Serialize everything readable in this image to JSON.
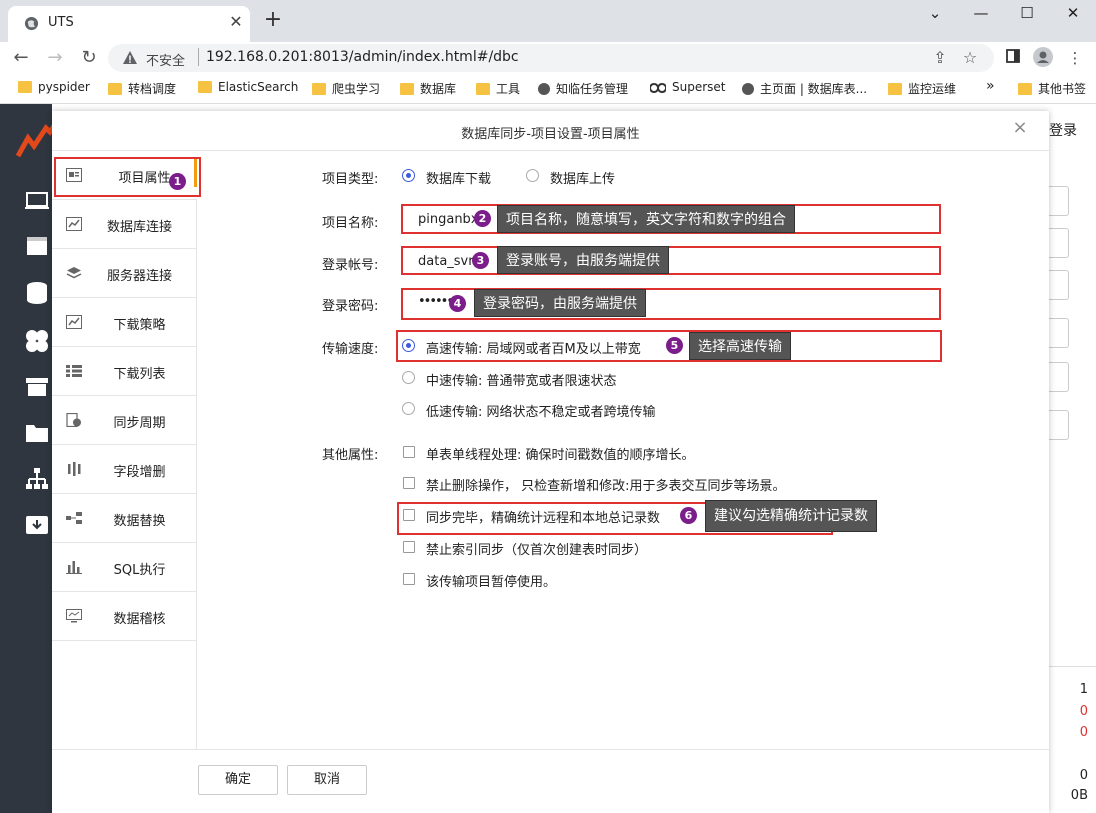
{
  "browser": {
    "tab_title": "UTS",
    "insecure_label": "不安全",
    "url": "192.168.0.201:8013/admin/index.html#/dbc",
    "bookmarks": [
      {
        "label": "pyspider",
        "icon": "folder"
      },
      {
        "label": "转档调度",
        "icon": "folder"
      },
      {
        "label": "ElasticSearch",
        "icon": "folder"
      },
      {
        "label": "爬虫学习",
        "icon": "folder"
      },
      {
        "label": "数据库",
        "icon": "folder"
      },
      {
        "label": "工具",
        "icon": "folder"
      },
      {
        "label": "知临任务管理",
        "icon": "globe"
      },
      {
        "label": "Superset",
        "icon": "superset"
      },
      {
        "label": "主页面 | 数据库表...",
        "icon": "globe"
      },
      {
        "label": "监控运维",
        "icon": "folder"
      }
    ],
    "more_label": "»",
    "other_bookmarks": "其他书签"
  },
  "app": {
    "login_label": "登录",
    "right_numbers": [
      "1",
      "0",
      "0",
      "0",
      "0B"
    ]
  },
  "modal": {
    "title": "数据库同步-项目设置-项目属性",
    "close_glyph": "×",
    "menu": [
      {
        "label": "项目属性",
        "icon": "card-icon"
      },
      {
        "label": "数据库连接",
        "icon": "chart-icon"
      },
      {
        "label": "服务器连接",
        "icon": "layers-icon"
      },
      {
        "label": "下载策略",
        "icon": "chart-icon"
      },
      {
        "label": "下载列表",
        "icon": "list-icon"
      },
      {
        "label": "同步周期",
        "icon": "clock-doc-icon"
      },
      {
        "label": "字段增删",
        "icon": "columns-icon"
      },
      {
        "label": "数据替换",
        "icon": "swap-icon"
      },
      {
        "label": "SQL执行",
        "icon": "bar-icon"
      },
      {
        "label": "数据稽核",
        "icon": "monitor-icon"
      }
    ],
    "form": {
      "type_label": "项目类型:",
      "type_options": [
        "数据库下载",
        "数据库上传"
      ],
      "name_label": "项目名称:",
      "name_value": "pinganbx",
      "account_label": "登录帐号:",
      "account_value": "data_svr",
      "password_label": "登录密码:",
      "password_value": "••••••",
      "speed_label": "传输速度:",
      "speed_options": [
        "高速传输: 局域网或者百M及以上带宽",
        "中速传输: 普通带宽或者限速状态",
        "低速传输: 网络状态不稳定或者跨境传输"
      ],
      "other_label": "其他属性:",
      "other_options": [
        "单表单线程处理: 确保时间戳数值的顺序增长。",
        "禁止删除操作， 只检查新增和修改:用于多表交互同步等场景。",
        "同步完毕，精确统计远程和本地总记录数",
        "禁止索引同步（仅首次创建表时同步）",
        "该传输项目暂停使用。"
      ]
    },
    "annotations": [
      {
        "num": "1"
      },
      {
        "num": "2",
        "text": "项目名称，随意填写，英文字符和数字的组合"
      },
      {
        "num": "3",
        "text": "登录账号，由服务端提供"
      },
      {
        "num": "4",
        "text": "登录密码，由服务端提供"
      },
      {
        "num": "5",
        "text": "选择高速传输"
      },
      {
        "num": "6",
        "text": "建议勾选精确统计记录数"
      }
    ],
    "ok_label": "确定",
    "cancel_label": "取消"
  }
}
